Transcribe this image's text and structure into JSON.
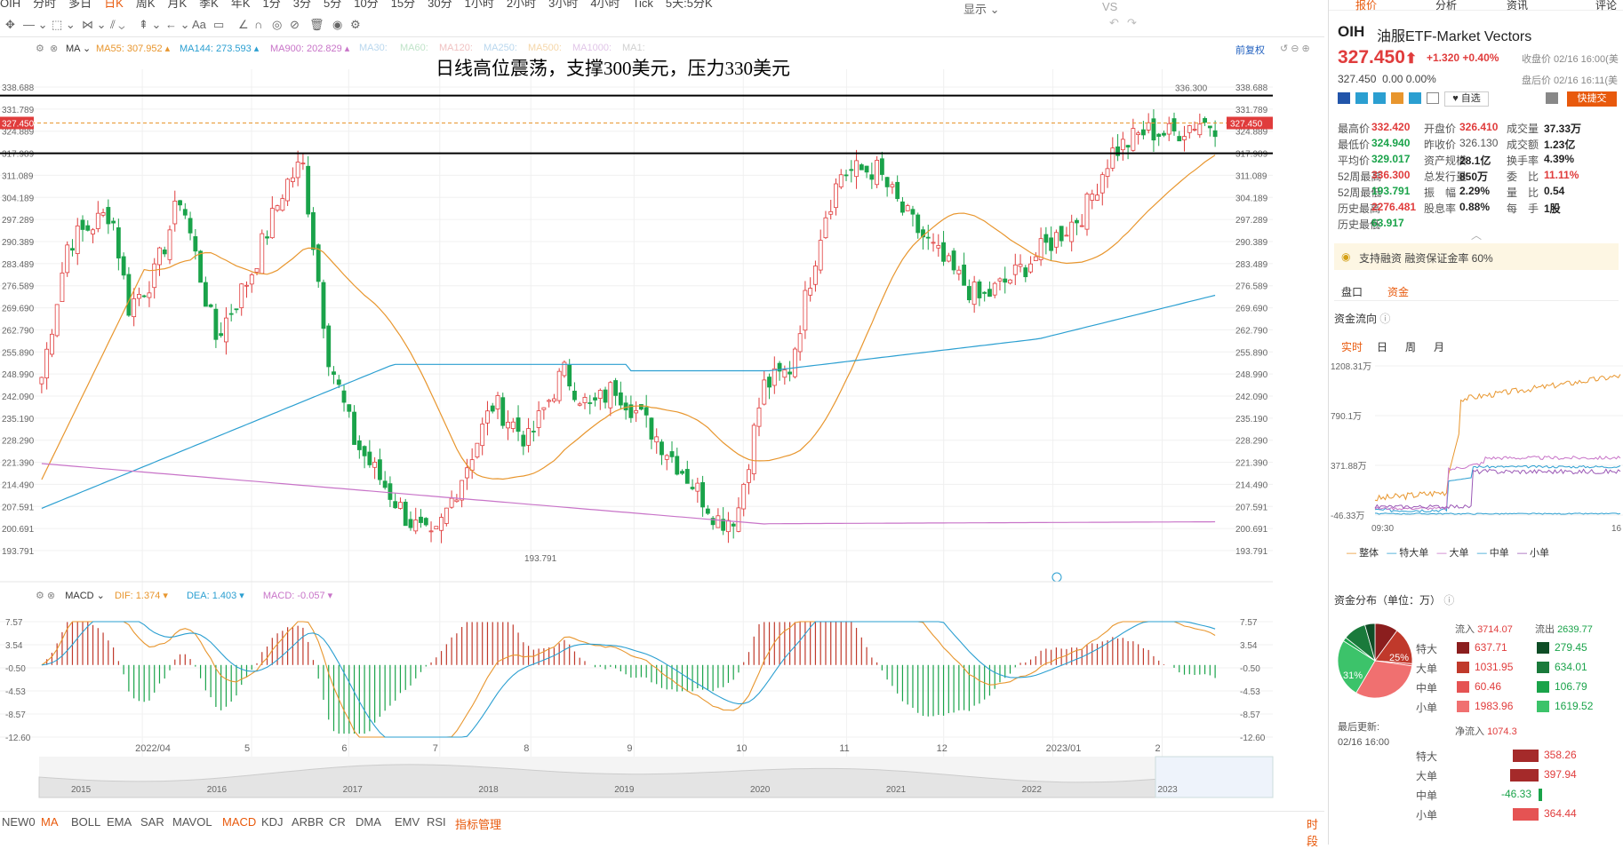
{
  "periods": [
    "OIH",
    "分时",
    "多日",
    "日K",
    "周K",
    "月K",
    "季K",
    "年K",
    "1分",
    "3分",
    "5分",
    "10分",
    "15分",
    "30分",
    "1小时",
    "2小时",
    "3小时",
    "4小时",
    "Tick",
    "5天:5分K"
  ],
  "active_period": "日K",
  "toolbar": {
    "display": "显示",
    "aa": "Aa",
    "vs": "VS"
  },
  "ma_legend": {
    "label": "MA",
    "ma55": "MA55:",
    "ma55v": "307.952",
    "ma144": "MA144:",
    "ma144v": "273.593",
    "ma900": "MA900:",
    "ma900v": "202.829",
    "ma30": "MA30:",
    "ma60": "MA60:",
    "ma120": "MA120:",
    "ma250": "MA250:",
    "ma500": "MA500:",
    "ma1000": "MA1000:",
    "ma1": "MA1:"
  },
  "restore": "前复权",
  "annotation": "日线高位震荡，支撑300美元，压力330美元",
  "price_axis": [
    "338.688",
    "331.789",
    "324.889",
    "317.989",
    "311.089",
    "304.189",
    "297.289",
    "290.389",
    "283.489",
    "276.589",
    "269.690",
    "262.790",
    "255.890",
    "248.990",
    "242.090",
    "235.190",
    "228.290",
    "221.390",
    "214.490",
    "207.591",
    "200.691",
    "193.791"
  ],
  "price_tag": "327.450",
  "hi_label": "336.300",
  "lo_label": "193.791",
  "macd_legend": {
    "name": "MACD",
    "dif": "DIF:",
    "difv": "1.374",
    "dea": "DEA:",
    "deav": "1.403",
    "macd": "MACD:",
    "macdv": "-0.057"
  },
  "macd_axis": [
    "7.57",
    "3.54",
    "-0.50",
    "-4.53",
    "-8.57",
    "-12.60"
  ],
  "months": [
    "2022/04",
    "5",
    "6",
    "7",
    "8",
    "9",
    "10",
    "11",
    "12",
    "2023/01",
    "2"
  ],
  "years": [
    "2015",
    "2016",
    "2017",
    "2018",
    "2019",
    "2020",
    "2021",
    "2022",
    "2023"
  ],
  "indicators": [
    "NEW0",
    "MA",
    "BOLL",
    "EMA",
    "SAR",
    "MAVOL",
    "MACD",
    "KDJ",
    "ARBR",
    "CR",
    "DMA",
    "EMV",
    "RSI",
    "指标管理"
  ],
  "indicator_active": "MACD",
  "timing": "时段",
  "chart_data": {
    "type": "line",
    "title": "日线高位震荡，支撑300美元，压力330美元",
    "ylim": [
      193.791,
      338.688
    ],
    "support": 317.989,
    "resistance": 336.3,
    "last": 327.45,
    "ma55_last": 307.952,
    "ma144_last": 273.593,
    "ma900_last": 202.829
  },
  "right": {
    "tabs": [
      "报价",
      "分析",
      "资讯",
      "评论"
    ],
    "code": "OIH",
    "name": "油服ETF-Market Vectors",
    "price": "327.450",
    "arrow": "⬆",
    "change": "+1.320",
    "pct": "+0.40%",
    "close_label": "收盘价 02/16 16:00(美",
    "ah_price": "327.450",
    "ah_change": "0.00",
    "ah_pct": "0.00%",
    "ah_label": "盘后价 02/16 16:11(美",
    "self_select": "自选",
    "quick_trade": "快捷交",
    "stats": [
      [
        "最高价",
        "332.420",
        "开盘价",
        "326.410",
        "成交量",
        "37.33万"
      ],
      [
        "最低价",
        "324.940",
        "昨收价",
        "326.130",
        "成交额",
        "1.23亿"
      ],
      [
        "平均价",
        "329.017",
        "资产规模",
        "28.1亿",
        "换手率",
        "4.39%"
      ],
      [
        "52周最高",
        "336.300",
        "总发行量",
        "850万",
        "委　比",
        "11.11%"
      ],
      [
        "52周最低",
        "193.791",
        "振　幅",
        "2.29%",
        "量　比",
        "0.54"
      ],
      [
        "历史最高",
        "2276.481",
        "股息率",
        "0.88%",
        "每　手",
        "1股"
      ],
      [
        "历史最低",
        "63.917",
        "",
        "",
        "",
        ""
      ]
    ],
    "margin": "支持融资  融资保证金率 60%",
    "subtabs": [
      "盘口",
      "资金"
    ],
    "flow_title": "资金流向",
    "flow_tabs": [
      "实时",
      "日",
      "周",
      "月"
    ],
    "flow_axis": [
      "1208.31万",
      "790.1万",
      "371.88万",
      "-46.33万"
    ],
    "flow_x": [
      "09:30",
      "16"
    ],
    "flow_legend": [
      "整体",
      "特大单",
      "大单",
      "中单",
      "小单"
    ],
    "dist_title": "资金分布（单位：万）",
    "in_label": "流入",
    "in_total": "3714.07",
    "out_label": "流出",
    "out_total": "2639.77",
    "pie_labels": [
      "25%",
      "31%"
    ],
    "dist": [
      [
        "特大",
        "637.71",
        "279.45"
      ],
      [
        "大单",
        "1031.95",
        "634.01"
      ],
      [
        "中单",
        "60.46",
        "106.79"
      ],
      [
        "小单",
        "1983.96",
        "1619.52"
      ]
    ],
    "updated_label": "最后更新:",
    "updated": "02/16 16:00",
    "net_title": "净流入",
    "net_total": "1074.3",
    "net": [
      [
        "特大",
        "358.26"
      ],
      [
        "大单",
        "397.94"
      ],
      [
        "中单",
        "-46.33"
      ],
      [
        "小单",
        "364.44"
      ]
    ]
  },
  "colors": {
    "up": "#e03c3c",
    "down": "#1aa34a",
    "ma55": "#e8962e",
    "ma144": "#2b9fd1",
    "ma900": "#c874c8"
  }
}
